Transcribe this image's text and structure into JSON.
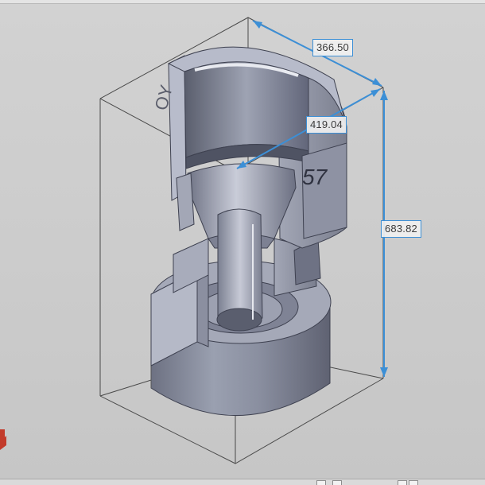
{
  "dimensions": {
    "width": "366.50",
    "depth": "419.04",
    "height": "683.82"
  },
  "part_labels": {
    "left_engraving": "OY",
    "right_engraving": "57"
  },
  "colors": {
    "dimension_line": "#3c8fd6",
    "part_body": "#8d91a2",
    "bounding_box": "#4a4a4a",
    "background": "#cbcbcb"
  }
}
